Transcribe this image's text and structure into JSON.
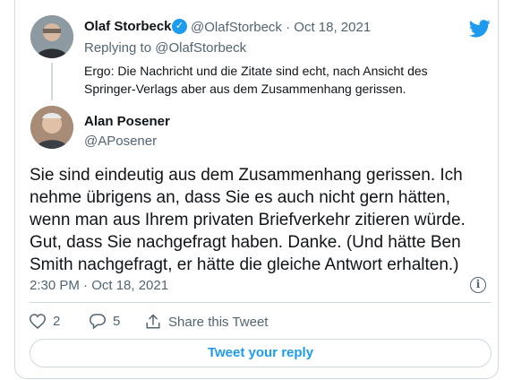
{
  "quoted_tweet": {
    "author_name": "Olaf Storbeck",
    "handle": "@OlafStorbeck",
    "separator": "·",
    "date": "Oct 18, 2021",
    "replying_to_prefix": "Replying to",
    "replying_to_handle": "@OlafStorbeck",
    "text": "Ergo: Die Nachricht und die Zitate sind echt, nach Ansicht des Springer-Verlags aber aus dem Zusammenhang gerissen."
  },
  "main_tweet": {
    "author_name": "Alan Posener",
    "handle": "@APosener",
    "text": "Sie sind eindeutig aus dem Zusammenhang gerissen. Ich nehme übrigens an, dass Sie es auch nicht gern hätten, wenn man aus Ihrem privaten Briefverkehr zitieren würde. Gut, dass Sie nachgefragt haben. Danke. (Und hätte Ben Smith nachgefragt, er hätte die gleiche Antwort erhalten.)",
    "timestamp": "2:30 PM · Oct 18, 2021"
  },
  "actions": {
    "like_count": "2",
    "reply_count": "5",
    "share_label": "Share this Tweet"
  },
  "reply_button_label": "Tweet your reply",
  "icons": {
    "brand": "twitter-bird-icon",
    "verified": "verified-badge-icon",
    "info": "info-icon",
    "like": "heart-icon",
    "reply": "reply-bubble-icon",
    "share": "share-icon"
  },
  "colors": {
    "accent": "#1d9bf0",
    "secondary_text": "#536471",
    "border": "#cfd9de"
  }
}
